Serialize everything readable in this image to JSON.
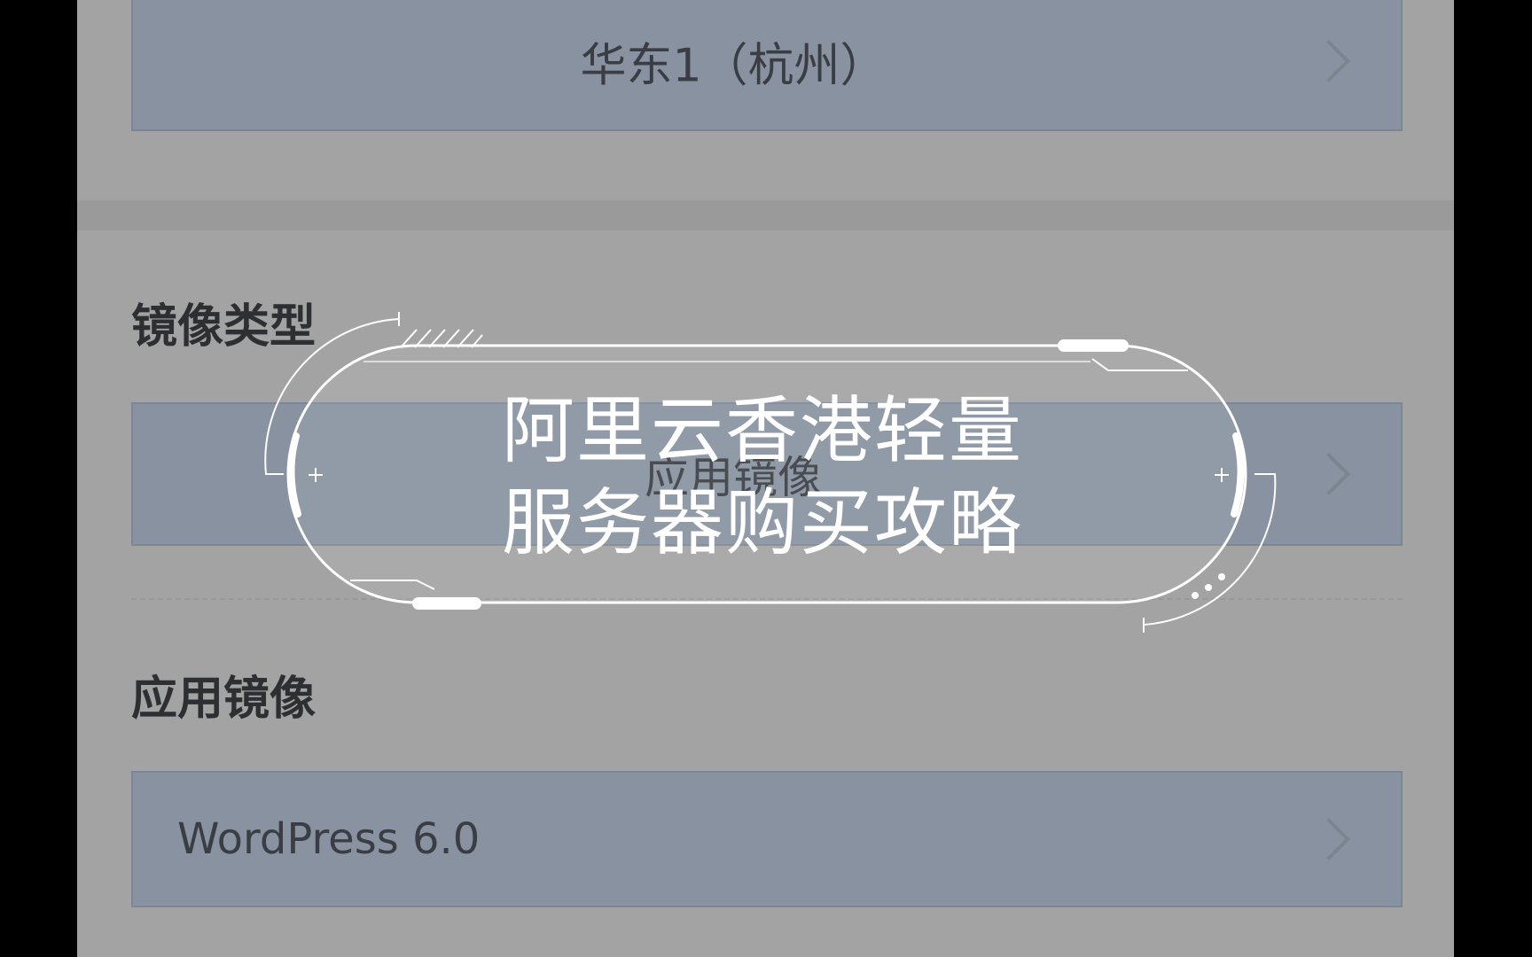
{
  "form": {
    "region_value": "华东1（杭州）",
    "image_type_label": "镜像类型",
    "image_type_value": "应用镜像",
    "app_image_label": "应用镜像",
    "app_image_value": "WordPress 6.0"
  },
  "overlay": {
    "title_line1": "阿里云香港轻量",
    "title_line2": "服务器购买攻略"
  },
  "icons": [
    "chevron-right-icon"
  ],
  "colors": {
    "background": "#a3a3a3",
    "select_fill": "#8892a0",
    "overlay_text": "#ffffff"
  }
}
